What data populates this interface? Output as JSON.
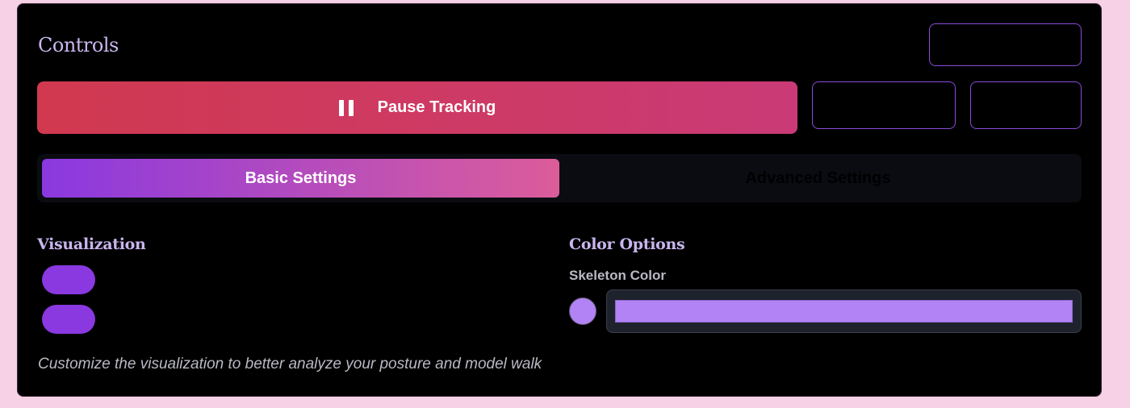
{
  "controls": {
    "title": "Controls",
    "pause_label": "Pause Tracking"
  },
  "tabs": [
    {
      "label": "Basic Settings",
      "active": true
    },
    {
      "label": "Advanced Settings",
      "active": false
    }
  ],
  "visualization": {
    "title": "Visualization",
    "toggles": [
      {
        "on": true
      },
      {
        "on": true
      }
    ]
  },
  "color_options": {
    "title": "Color Options",
    "skeleton_label": "Skeleton Color",
    "skeleton_color": "#b283f4"
  },
  "hint": "Customize the visualization to better analyze your posture and model walk",
  "colors": {
    "accent": "#8a38e0",
    "pause_start": "#d1394f",
    "pause_end": "#ca3a76"
  },
  "icons": {
    "pause": "pause-icon"
  }
}
